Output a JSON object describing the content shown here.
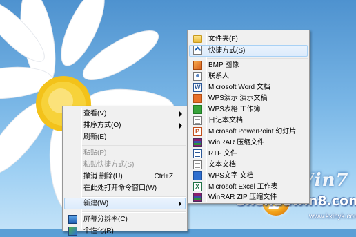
{
  "context_menu": {
    "items": [
      {
        "label": "查看(V)",
        "shortcut": "",
        "submenu": true,
        "disabled": false
      },
      {
        "label": "排序方式(O)",
        "shortcut": "",
        "submenu": true,
        "disabled": false
      },
      {
        "label": "刷新(E)",
        "shortcut": "",
        "submenu": false,
        "disabled": false
      },
      {
        "label": "粘贴(P)",
        "shortcut": "",
        "submenu": false,
        "disabled": true
      },
      {
        "label": "粘贴快捷方式(S)",
        "shortcut": "",
        "submenu": false,
        "disabled": true
      },
      {
        "label": "撤消 删除(U)",
        "shortcut": "Ctrl+Z",
        "submenu": false,
        "disabled": false
      },
      {
        "label": "在此处打开命令窗口(W)",
        "shortcut": "",
        "submenu": false,
        "disabled": false
      },
      {
        "label": "新建(W)",
        "shortcut": "",
        "submenu": true,
        "disabled": false
      },
      {
        "label": "屏幕分辨率(C)",
        "shortcut": "",
        "submenu": false,
        "disabled": false,
        "icon": "screen-resolution-icon"
      },
      {
        "label": "个性化(R)",
        "shortcut": "",
        "submenu": false,
        "disabled": false,
        "icon": "personalize-icon"
      }
    ]
  },
  "new_submenu": {
    "items": [
      {
        "label": "文件夹(F)",
        "icon": "folder-icon"
      },
      {
        "label": "快捷方式(S)",
        "icon": "shortcut-icon"
      },
      {
        "label": "BMP 图像",
        "icon": "bmp-image-icon"
      },
      {
        "label": "联系人",
        "icon": "contact-icon"
      },
      {
        "label": "Microsoft Word 文档",
        "icon": "word-document-icon"
      },
      {
        "label": "WPS演示 演示文稿",
        "icon": "wps-presentation-icon"
      },
      {
        "label": "WPS表格 工作簿",
        "icon": "wps-spreadsheet-icon"
      },
      {
        "label": "日记本文档",
        "icon": "journal-document-icon"
      },
      {
        "label": "Microsoft PowerPoint 幻灯片",
        "icon": "powerpoint-icon"
      },
      {
        "label": "WinRAR 压缩文件",
        "icon": "winrar-archive-icon"
      },
      {
        "label": "RTF 文件",
        "icon": "rtf-file-icon"
      },
      {
        "label": "文本文档",
        "icon": "text-document-icon"
      },
      {
        "label": "WPS文字 文档",
        "icon": "wps-writer-icon"
      },
      {
        "label": "Microsoft Excel 工作表",
        "icon": "excel-worksheet-icon"
      },
      {
        "label": "WinRAR ZIP 压缩文件",
        "icon": "winrar-zip-icon"
      }
    ]
  },
  "watermark": {
    "logo": "Win7",
    "brand": "Shenduwin8.com",
    "url": "www.kxinyk.com"
  },
  "colors": {
    "menu_bg": "#f0f0f0",
    "highlight_bg": "#dcebfc",
    "highlight_border": "#a8d1f5",
    "disabled_text": "#8d8d8d"
  }
}
